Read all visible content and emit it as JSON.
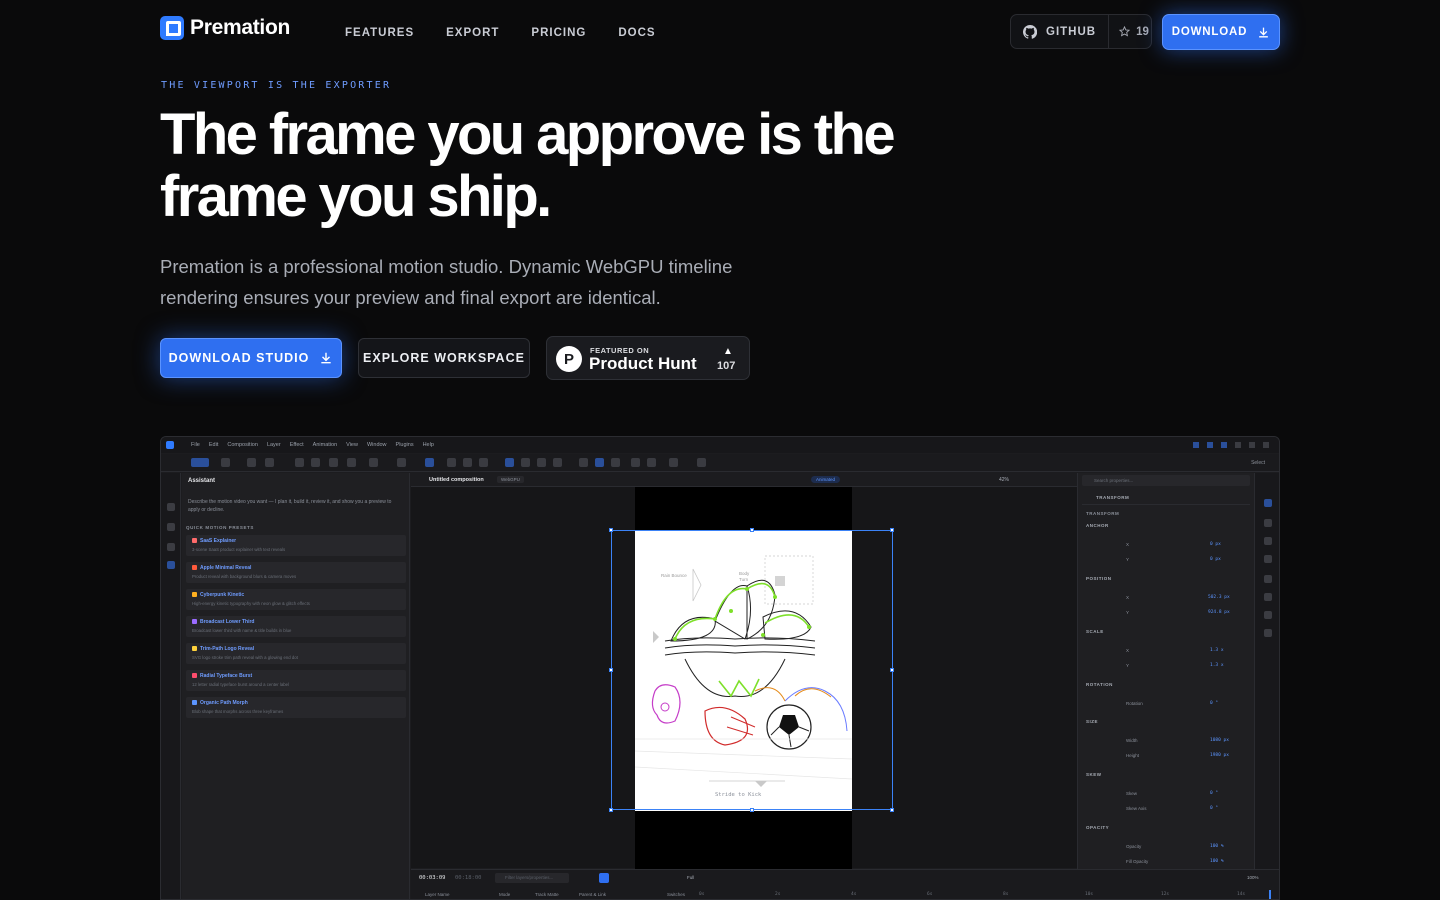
{
  "nav": {
    "brand": "Premation",
    "links": [
      "FEATURES",
      "EXPORT",
      "PRICING",
      "DOCS"
    ],
    "github_label": "GITHUB",
    "github_stars": "19",
    "download_label": "DOWNLOAD"
  },
  "hero": {
    "eyebrow": "THE VIEWPORT IS THE EXPORTER",
    "headline_line1": "The frame you approve is the",
    "headline_line2": "frame you ship.",
    "subtitle": "Premation is a professional motion studio. Dynamic WebGPU timeline rendering ensures your preview and final export are identical.",
    "cta_primary": "DOWNLOAD STUDIO",
    "cta_secondary": "EXPLORE WORKSPACE",
    "producthunt": {
      "featured": "FEATURED ON",
      "name": "Product Hunt",
      "votes": "107"
    }
  },
  "app": {
    "menu": [
      "File",
      "Edit",
      "Composition",
      "Layer",
      "Effect",
      "Animation",
      "View",
      "Window",
      "Plugins",
      "Help"
    ],
    "select_label": "Select",
    "composition_tab": "Untitled composition",
    "renderer_badge": "WebGPU",
    "animated_badge": "Animated",
    "zoom": "42%",
    "assistant": {
      "title": "Assistant",
      "description": "Describe the motion video you want — I plan it, build it, review it, and show you a preview to apply or decline.",
      "presets_title": "QUICK MOTION PRESETS",
      "presets": [
        {
          "name": "SaaS Explainer",
          "desc": "3-scene SaaS product explainer with text reveals",
          "color": "#ff6b6b"
        },
        {
          "name": "Apple Minimal Reveal",
          "desc": "Product reveal with background blurs & camera moves",
          "color": "#ff5a3c"
        },
        {
          "name": "Cyberpunk Kinetic",
          "desc": "High-energy kinetic typography with neon glow & glitch effects",
          "color": "#ffb020"
        },
        {
          "name": "Broadcast Lower Third",
          "desc": "Broadcast lower third with name & title builds in blue",
          "color": "#9b6bff"
        },
        {
          "name": "Trim-Path Logo Reveal",
          "desc": "SVG logo stroke trim path reveal with a glowing end dot",
          "color": "#ffd23c"
        },
        {
          "name": "Radial Typeface Burst",
          "desc": "12 letter radial typeface burst around a center label",
          "color": "#ff4d6d"
        },
        {
          "name": "Organic Path Morph",
          "desc": "Blob shape that morphs across three keyframes",
          "color": "#5c95ff"
        }
      ]
    },
    "canvas": {
      "caption": "Stride to Kick",
      "label_bounce": "Rain Bounce",
      "label_turn": "Body Turn"
    },
    "properties": {
      "search_placeholder": "Search properties...",
      "section": "TRANSFORM",
      "group": "TRANSFORM",
      "anchor_title": "ANCHOR",
      "anchor_x": "0 px",
      "anchor_y": "0 px",
      "position_title": "POSITION",
      "position_x": "502.3 px",
      "position_y": "924.8 px",
      "scale_title": "SCALE",
      "scale_x": "1.3 x",
      "scale_y": "1.3 x",
      "rotation_title": "ROTATION",
      "rotation_label": "Rotation",
      "rotation_val": "0 °",
      "size_title": "SIZE",
      "width_label": "Width",
      "width_val": "1080 px",
      "height_label": "Height",
      "height_val": "1980 px",
      "skew_title": "SKEW",
      "skew_label": "Skew",
      "skew_val": "0 °",
      "skew_axis_label": "Skew Axis",
      "skew_axis_val": "0 °",
      "opacity_title": "OPACITY",
      "opacity_label": "Opacity",
      "opacity_val": "100 %",
      "fill_label": "Fill Opacity",
      "fill_val": "100 %",
      "x": "X",
      "y": "Y"
    },
    "timeline": {
      "current": "00:03:09",
      "total": "00:18:00",
      "search_placeholder": "Filter layers/properties...",
      "headers": [
        "Layer Name",
        "Mode",
        "Track Matte",
        "Parent & Link",
        "Switches"
      ],
      "ruler": [
        "0s",
        "2s",
        "4s",
        "6s",
        "8s",
        "10s",
        "12s",
        "14s"
      ],
      "zoom": "100%",
      "quality": "Full"
    }
  }
}
